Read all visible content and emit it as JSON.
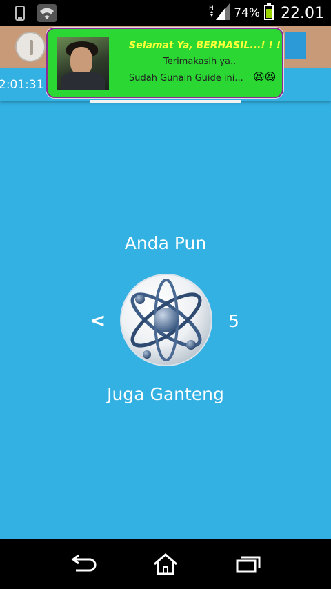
{
  "status_bar": {
    "battery_percent": "74%",
    "clock": "22.01",
    "icons": [
      "phone-icon",
      "wifi-icon",
      "signal-icon",
      "battery-icon"
    ]
  },
  "background_app": {
    "timer": "2:01:31"
  },
  "toast": {
    "title": "Selamat Ya, BERHASIL...! ! !",
    "line2": "Terimakasih ya..",
    "line3": "Sudah Gunain Guide ini...",
    "emoji": "😆😆",
    "title_color": "#ffff3a",
    "background_color": "#2bd833",
    "border_color": "#8a2a96"
  },
  "main": {
    "heading": "Anda Pun",
    "prev_label": "<",
    "count": "5",
    "footer": "Juga Ganteng",
    "icon": "atom-logo-icon",
    "background_color": "#33b1e3"
  },
  "navbar": {
    "icons": [
      "back-icon",
      "home-icon",
      "recent-apps-icon"
    ]
  }
}
